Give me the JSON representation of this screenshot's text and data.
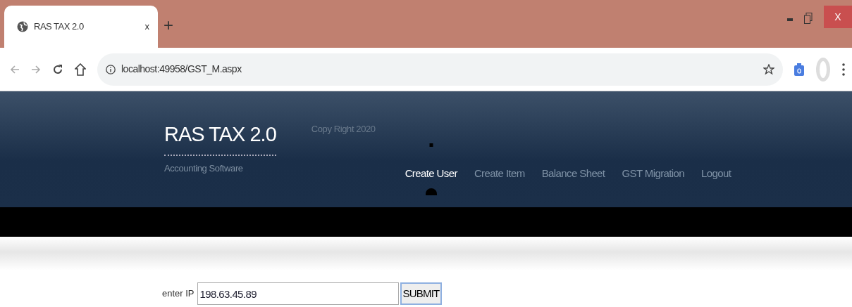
{
  "browser": {
    "tab_title": "RAS TAX 2.0",
    "tab_close": "x",
    "new_tab": "+",
    "address": "localhost:49958/GST_M.aspx",
    "window_close": "X"
  },
  "header": {
    "title": "RAS TAX 2.0",
    "subtitle": "Accounting Software",
    "copyright": "Copy Right 2020"
  },
  "nav": [
    {
      "label": "Create User",
      "selected": true
    },
    {
      "label": "Create Item",
      "selected": false
    },
    {
      "label": "Balance Sheet",
      "selected": false
    },
    {
      "label": "GST Migration",
      "selected": false
    },
    {
      "label": "Logout",
      "selected": false
    }
  ],
  "form": {
    "label": "enter IP",
    "value": "198.63.45.89",
    "button": "SUBMIT"
  }
}
